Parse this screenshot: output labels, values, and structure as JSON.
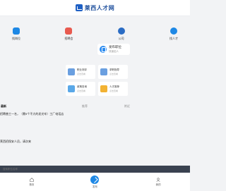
{
  "header": {
    "logo_text": "莱西人才网"
  },
  "quick_menu": [
    {
      "label": "找岗位",
      "icon": "briefcase-icon",
      "color": "#1e88e5"
    },
    {
      "label": "招聘会",
      "icon": "book-icon",
      "color": "#e85a4f"
    },
    {
      "label": "公司",
      "icon": "person-icon",
      "color": "#2b6cc4"
    },
    {
      "label": "找人才",
      "icon": "gear-icon",
      "color": "#1e88e5"
    }
  ],
  "post_job": {
    "title": "发布职位",
    "subtitle": "快速招人"
  },
  "services": [
    {
      "title": "职业测评",
      "sub": "点击查看",
      "icon": "assessment-icon",
      "color": "#6a9fe0"
    },
    {
      "title": "求职指导",
      "sub": "点击查看",
      "icon": "guide-icon",
      "color": "#6a9fe0"
    },
    {
      "title": "政策查询",
      "sub": "点击查看",
      "icon": "policy-icon",
      "color": "#5aa8e8"
    },
    {
      "title": "人才推荐",
      "sub": "点击查看",
      "icon": "chart-icon",
      "color": "#f2b233"
    }
  ],
  "tabs": [
    {
      "label": "最新"
    },
    {
      "label": "推荐"
    },
    {
      "label": "附近"
    }
  ],
  "feed": [
    {
      "text": "招聘普工一名，（需9个不大的发光牢）工厂电话店"
    },
    {
      "text": "莱西招保安人员，请次来"
    }
  ],
  "search": {
    "placeholder": "搜索职位名称"
  },
  "bottom_nav": [
    {
      "label": "首页",
      "icon": "home-icon"
    },
    {
      "label": "发布",
      "icon": "send-icon"
    },
    {
      "label": "我的",
      "icon": "user-icon"
    }
  ]
}
